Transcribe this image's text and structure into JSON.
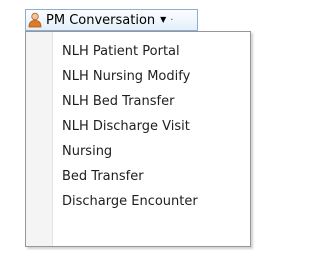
{
  "toolbar": {
    "button_label": "PM Conversation",
    "icon": "person-icon",
    "caret_icon": "chevron-down-icon"
  },
  "menu": {
    "items": [
      {
        "label": "NLH Patient Portal"
      },
      {
        "label": "NLH Nursing Modify"
      },
      {
        "label": "NLH Bed Transfer"
      },
      {
        "label": "NLH Discharge Visit"
      },
      {
        "label": "Nursing"
      },
      {
        "label": "Bed Transfer"
      },
      {
        "label": "Discharge Encounter"
      }
    ]
  },
  "colors": {
    "button_border": "#8eaed3",
    "icon_body": "#e07b24",
    "icon_head": "#f1c39a"
  }
}
